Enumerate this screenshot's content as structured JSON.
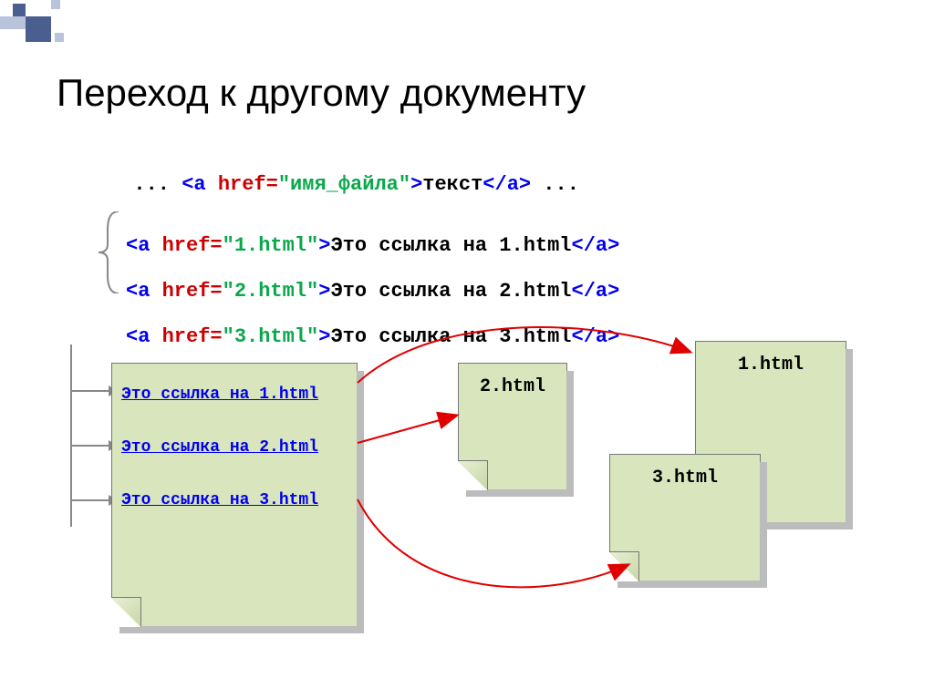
{
  "title": "Переход к другому документу",
  "syntax": {
    "prefix": "... ",
    "open1": "<a ",
    "attr": "href=",
    "val": "\"имя_файла\"",
    "close1": ">",
    "text": "текст",
    "close2": "</a>",
    "suffix": " ..."
  },
  "examples": [
    {
      "open": "<a ",
      "attr": "href=",
      "val": "\"1.html\"",
      "mid": ">",
      "text": "Это ссылка на 1.html",
      "close": "</a>"
    },
    {
      "open": "<a ",
      "attr": "href=",
      "val": "\"2.html\"",
      "mid": ">",
      "text": "Это ссылка на 2.html",
      "close": "</a>"
    },
    {
      "open": "<a ",
      "attr": "href=",
      "val": "\"3.html\"",
      "mid": ">",
      "text": "Это ссылка на 3.html",
      "close": "</a>"
    }
  ],
  "source_doc": {
    "links": [
      "Это ссылка на 1.html",
      "Это ссылка на 2.html",
      "Это ссылка на 3.html"
    ]
  },
  "targets": {
    "d1": "1.html",
    "d2": "2.html",
    "d3": "3.html"
  }
}
